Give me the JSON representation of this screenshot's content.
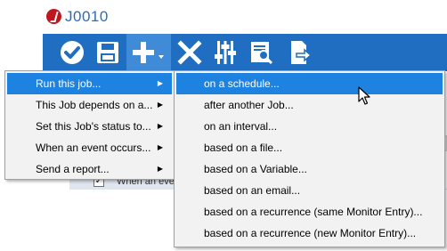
{
  "window": {
    "title": "J0010"
  },
  "toolbar": {
    "buttons": [
      {
        "name": "approve-icon"
      },
      {
        "name": "save-icon"
      },
      {
        "name": "add-icon"
      },
      {
        "name": "delete-icon"
      },
      {
        "name": "sliders-icon"
      },
      {
        "name": "report-icon"
      },
      {
        "name": "export-icon"
      }
    ]
  },
  "grid": {
    "row_text": "When an eve",
    "right_text": "Al"
  },
  "menu": {
    "items": [
      {
        "label": "Run this job..."
      },
      {
        "label": "This Job depends on a..."
      },
      {
        "label": "Set this Job's status to..."
      },
      {
        "label": "When an event occurs..."
      },
      {
        "label": "Send a report..."
      }
    ]
  },
  "submenu": {
    "items": [
      {
        "label": "on a schedule..."
      },
      {
        "label": "after another Job..."
      },
      {
        "label": "on an interval..."
      },
      {
        "label": "based on a file..."
      },
      {
        "label": "based on a Variable..."
      },
      {
        "label": "based on an email..."
      },
      {
        "label": "based on a recurrence (same Monitor Entry)..."
      },
      {
        "label": "based on a recurrence (new Monitor Entry)..."
      }
    ]
  },
  "colors": {
    "toolbar": "#1f6ec1",
    "highlight": "#1e82e0",
    "title": "#2a6db8"
  }
}
